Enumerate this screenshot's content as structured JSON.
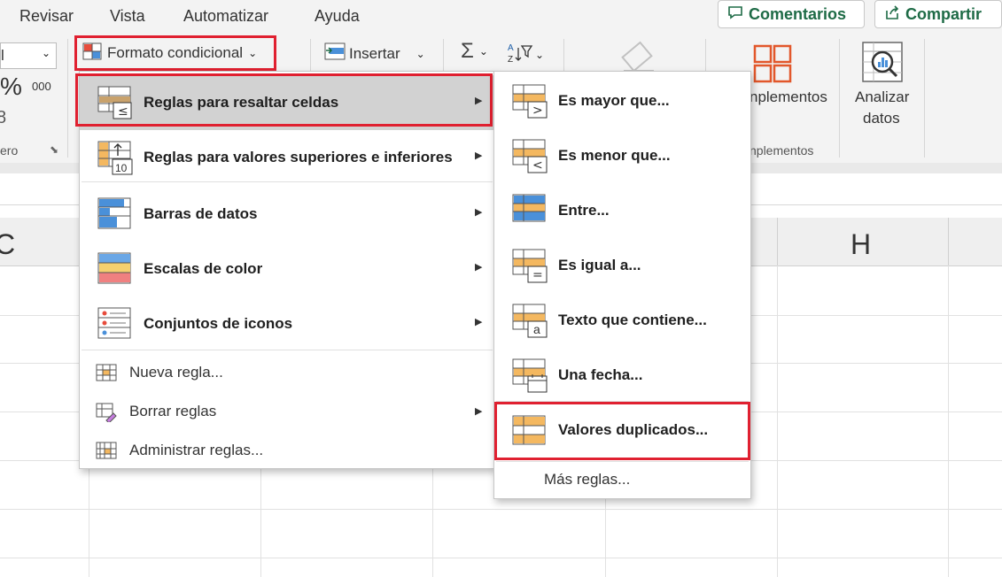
{
  "tabs": [
    "Revisar",
    "Vista",
    "Automatizar",
    "Ayuda"
  ],
  "top_buttons": {
    "comments": "Comentarios",
    "share": "Compartir"
  },
  "ribbon": {
    "format_dropdown_fragment": "l",
    "percent": "%",
    "thousands": "000",
    "decimals_fragment": "8",
    "group_number_fragment": "ero",
    "conditional_format": "Formato condicional",
    "insert": "Insertar",
    "addins_label_fragment": "nplementos",
    "addins_group_fragment": "nplementos",
    "analyze_line1": "Analizar",
    "analyze_line2": "datos"
  },
  "columns": {
    "c": "C",
    "h": "H"
  },
  "main_menu": [
    {
      "label": "Reglas para resaltar celdas",
      "has_submenu": true,
      "highlighted": true
    },
    {
      "label": "Reglas para valores superiores e inferiores",
      "has_submenu": true
    },
    {
      "label": "Barras de datos",
      "has_submenu": true
    },
    {
      "label": "Escalas de color",
      "has_submenu": true
    },
    {
      "label": "Conjuntos de iconos",
      "has_submenu": true
    }
  ],
  "main_menu_small": [
    {
      "label": "Nueva regla...",
      "has_submenu": false
    },
    {
      "label": "Borrar reglas",
      "has_submenu": true
    },
    {
      "label": "Administrar reglas...",
      "has_submenu": false
    }
  ],
  "submenu": [
    {
      "label": "Es mayor que...",
      "icon": "greater-than-icon",
      "symbol": ">"
    },
    {
      "label": "Es menor que...",
      "icon": "less-than-icon",
      "symbol": "<"
    },
    {
      "label": "Entre...",
      "icon": "between-icon",
      "symbol": ""
    },
    {
      "label": "Es igual a...",
      "icon": "equal-icon",
      "symbol": "="
    },
    {
      "label": "Texto que contiene...",
      "icon": "text-contains-icon",
      "symbol": "a"
    },
    {
      "label": "Una fecha...",
      "icon": "date-icon",
      "symbol": ""
    },
    {
      "label": "Valores duplicados...",
      "icon": "duplicate-values-icon",
      "symbol": "",
      "highlighted": true
    }
  ],
  "submenu_more": "Más reglas...",
  "icon_symbols": {
    "highlight": "≤",
    "top_bottom": "10",
    "sigma": "Σ"
  },
  "colors": {
    "highlight_border": "#e02030",
    "accent_green": "#1e6b46",
    "orange": "#f4b860",
    "blue": "#4a90d9"
  }
}
